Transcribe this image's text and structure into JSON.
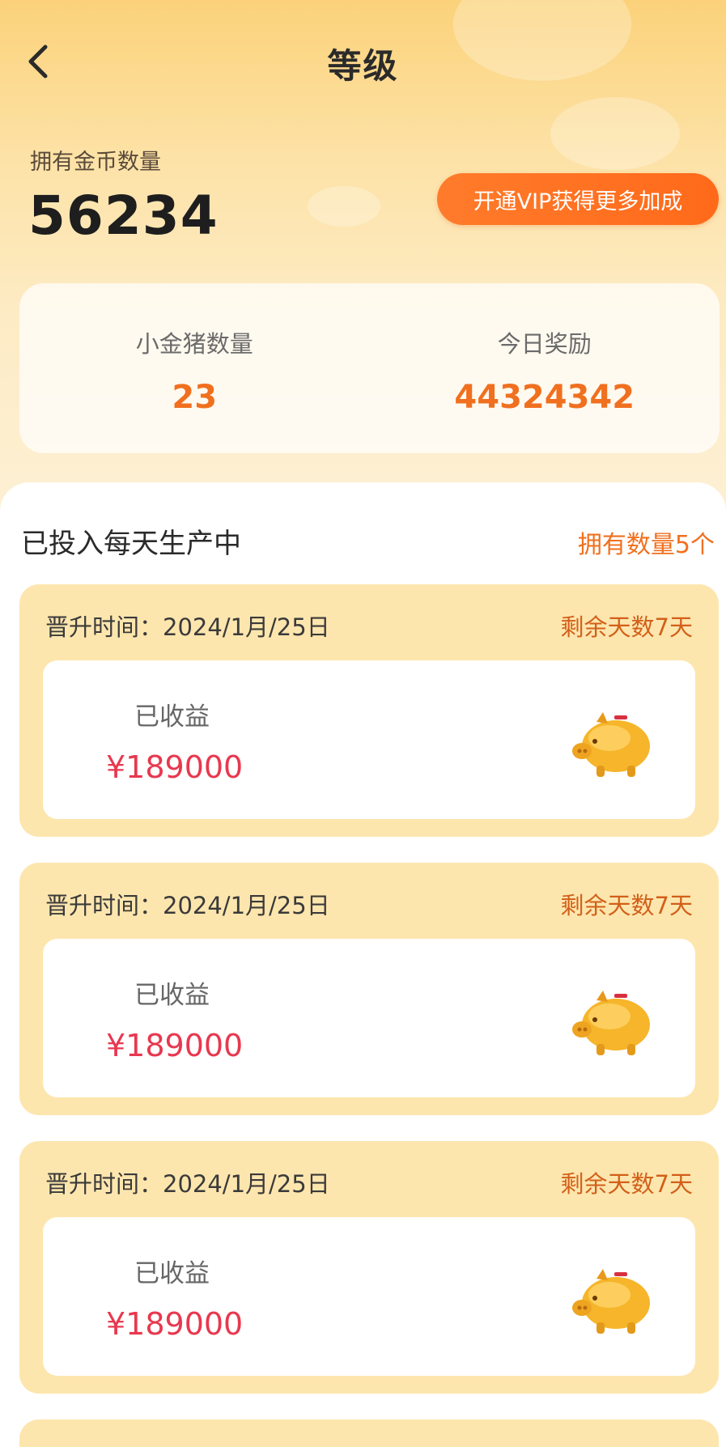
{
  "header": {
    "title": "等级"
  },
  "coins": {
    "label": "拥有金币数量",
    "value": "56234"
  },
  "vip_button": "开通VIP获得更多加成",
  "stats": [
    {
      "label": "小金猪数量",
      "value": "23"
    },
    {
      "label": "今日奖励",
      "value": "44324342"
    }
  ],
  "section": {
    "title": "已投入每天生产中",
    "count": "拥有数量5个"
  },
  "items": [
    {
      "promotion_time": "晋升时间：2024/1月/25日",
      "remaining": "剩余天数7天",
      "earned_label": "已收益",
      "earned_value": "¥189000"
    },
    {
      "promotion_time": "晋升时间：2024/1月/25日",
      "remaining": "剩余天数7天",
      "earned_label": "已收益",
      "earned_value": "¥189000"
    },
    {
      "promotion_time": "晋升时间：2024/1月/25日",
      "remaining": "剩余天数7天",
      "earned_label": "已收益",
      "earned_value": "¥189000"
    }
  ],
  "colors": {
    "accent": "#f0701f",
    "money": "#e8384f",
    "card": "#fde6ae"
  },
  "icons": {
    "back": "chevron-left-icon",
    "pig": "golden-pig-icon"
  }
}
